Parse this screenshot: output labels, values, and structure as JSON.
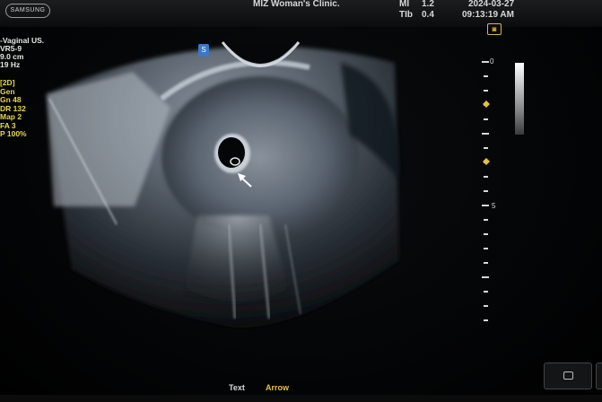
{
  "header": {
    "logo": "SAMSUNG",
    "clinic": "MIZ Woman's Clinic.",
    "mi_label": "MI",
    "mi_value": "1.2",
    "tib_label": "TIb",
    "tib_value": "0.4",
    "date": "2024-03-27",
    "time": "09:13:19 AM"
  },
  "probe": {
    "mode": "-Vaginal US.",
    "probe": "VR5-9",
    "depth": "9.0 cm",
    "frame_rate": "19 Hz"
  },
  "imaging": {
    "mode": "[2D]",
    "gen": "Gen",
    "gain": "Gn  48",
    "dynamic_range": "DR  132",
    "map": "Map  2",
    "fa": "FA  3",
    "power": "P    100%"
  },
  "scale": {
    "top_label": "0",
    "mid_label": "5"
  },
  "orientation_marker": "S",
  "footer": {
    "text_label": "Text",
    "arrow_label": "Arrow"
  },
  "colors": {
    "accent_yellow": "#e6d64a",
    "marker_blue": "#3a78c8"
  }
}
